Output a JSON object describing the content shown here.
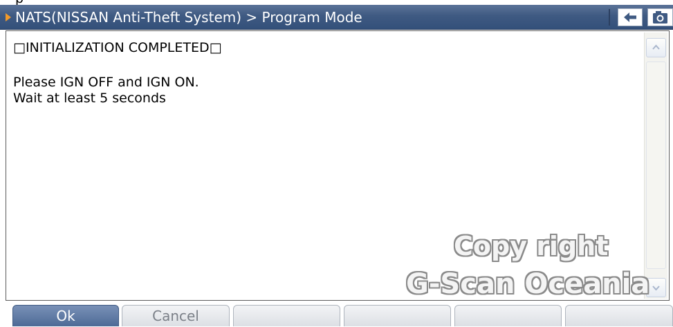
{
  "window": {
    "title": "NATS(NISSAN Anti-Theft System) > Program Mode",
    "top_strip_text": "p"
  },
  "toolbar": {
    "back_icon": "back-arrow-icon",
    "camera_icon": "camera-icon"
  },
  "message": {
    "heading": "□INITIALIZATION COMPLETED□",
    "line1": "Please IGN OFF and IGN ON.",
    "line2": "Wait at least 5 seconds"
  },
  "watermark": {
    "line1": "Copy right",
    "line2": "G-Scan Oceania"
  },
  "buttons": {
    "ok": "Ok",
    "cancel": "Cancel",
    "f3": "",
    "f4": "",
    "f5": "",
    "f6": ""
  },
  "colors": {
    "titlebar": "#3f5a82",
    "accent_arrow": "#f39a2a",
    "primary_button": "#4d6a96",
    "disabled_text": "#7b8088"
  }
}
